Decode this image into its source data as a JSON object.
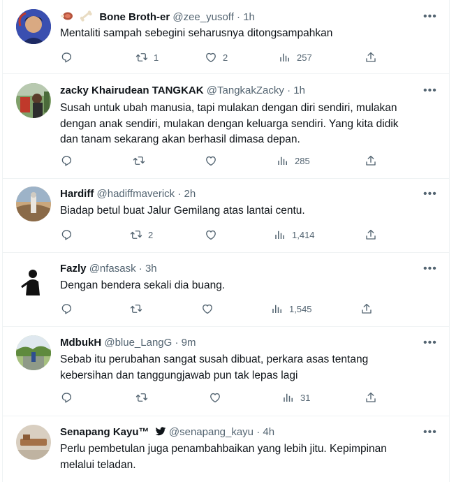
{
  "tweets": [
    {
      "name": "Bone Broth-er",
      "handle": "@zee_yusoff",
      "time": "· 1h",
      "text": "Mentaliti sampah sebegini seharusnya ditongsampahkan",
      "replies": "",
      "retweets": "1",
      "likes": "2",
      "views": "257"
    },
    {
      "name": "zacky Khairudean TANGKAK",
      "handle": "@TangkakZacky",
      "time": "· 1h",
      "text": "Susah untuk ubah manusia, tapi mulakan dengan diri sendiri, mulakan dengan anak sendiri, mulakan dengan keluarga sendiri. Yang kita didik dan tanam sekarang akan berhasil dimasa depan.",
      "replies": "",
      "retweets": "",
      "likes": "",
      "views": "285"
    },
    {
      "name": "Hardiff",
      "handle": "@hadiffmaverick",
      "time": "· 2h",
      "text": "Biadap betul buat Jalur Gemilang atas lantai centu.",
      "replies": "",
      "retweets": "2",
      "likes": "",
      "views": "1,414"
    },
    {
      "name": "Fazly",
      "handle": "@nfasask",
      "time": "· 3h",
      "text": "Dengan bendera sekali dia buang.",
      "replies": "",
      "retweets": "",
      "likes": "",
      "views": "1,545"
    },
    {
      "name": "MdbukH",
      "handle": "@blue_LangG",
      "time": "· 9m",
      "text": "Sebab itu perubahan sangat susah dibuat, perkara asas tentang kebersihan dan tanggungjawab pun tak lepas lagi",
      "replies": "",
      "retweets": "",
      "likes": "",
      "views": "31"
    },
    {
      "name": "Senapang Kayu™",
      "handle": "@senapang_kayu",
      "time": "· 4h",
      "text": "Perlu pembetulan juga penambahbaikan yang lebih jitu. Kepimpinan melalui teladan.",
      "replies": "",
      "retweets": "",
      "likes": "",
      "views": ""
    }
  ],
  "ui": {
    "more_label": "•••"
  },
  "colors": {
    "text": "#0f1419",
    "secondary": "#536471",
    "divider": "#eff3f4"
  },
  "icons": [
    "reply-icon",
    "retweet-icon",
    "like-icon",
    "views-icon",
    "share-icon",
    "more-icon",
    "bird-icon",
    "meat-emoji-icon",
    "bone-emoji-icon"
  ]
}
